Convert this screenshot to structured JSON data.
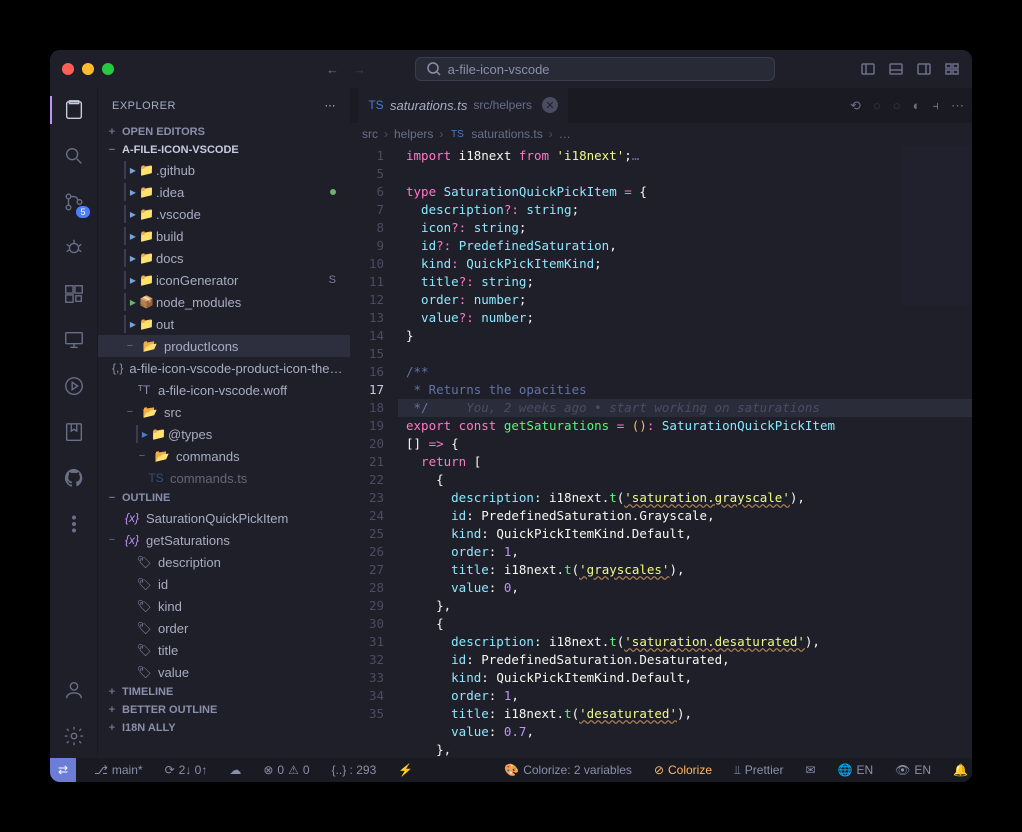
{
  "window": {
    "search": "a-file-icon-vscode"
  },
  "explorer": {
    "title": "EXPLORER",
    "sections": {
      "openEditors": "OPEN EDITORS",
      "project": "A-FILE-ICON-VSCODE",
      "outline": "OUTLINE",
      "timeline": "TIMELINE",
      "betterOutline": "BETTER OUTLINE",
      "i18nAlly": "I18N ALLY"
    },
    "tree": {
      "github": ".github",
      "idea": ".idea",
      "vscode": ".vscode",
      "build": "build",
      "docs": "docs",
      "iconGenerator": "iconGenerator",
      "iconGeneratorStatus": "S",
      "nodeModules": "node_modules",
      "out": "out",
      "productIcons": "productIcons",
      "piFile1": "a-file-icon-vscode-product-icon-the…",
      "piFile2": "a-file-icon-vscode.woff",
      "src": "src",
      "types": "@types",
      "commands": "commands",
      "commandsTs": "commands.ts"
    },
    "outline": {
      "item1": "SaturationQuickPickItem",
      "item2": "getSaturations",
      "description": "description",
      "id": "id",
      "kind": "kind",
      "order": "order",
      "title": "title",
      "value": "value"
    }
  },
  "activitybar": {
    "scmBadge": "5"
  },
  "tab": {
    "filename": "saturations.ts",
    "path": "src/helpers"
  },
  "breadcrumb": {
    "p1": "src",
    "p2": "helpers",
    "p3": "saturations.ts",
    "p4": "…"
  },
  "code": {
    "lines": [
      "1",
      "5",
      "6",
      "7",
      "8",
      "9",
      "10",
      "11",
      "12",
      "13",
      "14",
      "15",
      "16",
      "17",
      "18",
      "",
      "19",
      "20",
      "21",
      "22",
      "23",
      "24",
      "25",
      "26",
      "27",
      "28",
      "29",
      "30",
      "31",
      "32",
      "33",
      "34",
      "35"
    ],
    "l1a": "import",
    "l1b": " i18next ",
    "l1c": "from",
    "l1d": " 'i18next'",
    "l1e": ";",
    "l1f": "…",
    "l5a": "type",
    "l5b": " SaturationQuickPickItem ",
    "l5c": "=",
    "l5d": " {",
    "l6a": "  description",
    "l6b": "?:",
    "l6c": " string",
    "l6d": ";",
    "l7a": "  icon",
    "l7b": "?:",
    "l7c": " string",
    "l7d": ";",
    "l8a": "  id",
    "l8b": "?:",
    "l8c": " PredefinedSaturation",
    "l8d": ",",
    "l9a": "  kind",
    "l9b": ":",
    "l9c": " QuickPickItemKind",
    "l9d": ";",
    "l10a": "  title",
    "l10b": "?:",
    "l10c": " string",
    "l10d": ";",
    "l11a": "  order",
    "l11b": ":",
    "l11c": " number",
    "l11d": ";",
    "l12a": "  value",
    "l12b": "?:",
    "l12c": " number",
    "l12d": ";",
    "l13": "}",
    "l15": "/**",
    "l16": " * Returns the opacities",
    "l17": " */",
    "l17b": "     You, 2 weeks ago • start working on saturations",
    "l18a": "export",
    "l18b": " const ",
    "l18c": "getSaturations",
    "l18d": " = ",
    "l18e": "()",
    "l18f": ":",
    "l18g": " SaturationQuickPickItem",
    "l18x": "[] ",
    "l18y": "=>",
    "l18z": " {",
    "l19a": "  return",
    "l19b": " [",
    "l20": "    {",
    "l21a": "      description",
    "l21b": ": ",
    "l21c": "i18next",
    "l21d": ".",
    "l21e": "t",
    "l21f": "(",
    "l21g": "'saturation.grayscale'",
    "l21h": "),",
    "l22a": "      id",
    "l22b": ": ",
    "l22c": "PredefinedSaturation",
    "l22d": ".",
    "l22e": "Grayscale",
    "l22f": ",",
    "l23a": "      kind",
    "l23b": ": ",
    "l23c": "QuickPickItemKind",
    "l23d": ".",
    "l23e": "Default",
    "l23f": ",",
    "l24a": "      order",
    "l24b": ": ",
    "l24c": "1",
    "l24d": ",",
    "l25a": "      title",
    "l25b": ": ",
    "l25c": "i18next",
    "l25d": ".",
    "l25e": "t",
    "l25f": "(",
    "l25g": "'grayscales'",
    "l25h": "),",
    "l26a": "      value",
    "l26b": ": ",
    "l26c": "0",
    "l26d": ",",
    "l27": "    },",
    "l28": "    {",
    "l29a": "      description",
    "l29b": ": ",
    "l29c": "i18next",
    "l29d": ".",
    "l29e": "t",
    "l29f": "(",
    "l29g": "'saturation.desaturated'",
    "l29h": "),",
    "l30a": "      id",
    "l30b": ": ",
    "l30c": "PredefinedSaturation",
    "l30d": ".",
    "l30e": "Desaturated",
    "l30f": ",",
    "l31a": "      kind",
    "l31b": ": ",
    "l31c": "QuickPickItemKind",
    "l31d": ".",
    "l31e": "Default",
    "l31f": ",",
    "l32a": "      order",
    "l32b": ": ",
    "l32c": "1",
    "l32d": ",",
    "l33a": "      title",
    "l33b": ": ",
    "l33c": "i18next",
    "l33d": ".",
    "l33e": "t",
    "l33f": "(",
    "l33g": "'desaturated'",
    "l33h": "),",
    "l34a": "      value",
    "l34b": ": ",
    "l34c": "0.7",
    "l34d": ",",
    "l35": "    },"
  },
  "status": {
    "branch": "main*",
    "sync": "2↓ 0↑",
    "errors": "0",
    "warnings": "0",
    "bracket": "{..} : 293",
    "colorize": "Colorize: 2 variables",
    "colorizeBtn": "Colorize",
    "prettier": "Prettier",
    "lang1": "EN",
    "lang2": "EN"
  }
}
